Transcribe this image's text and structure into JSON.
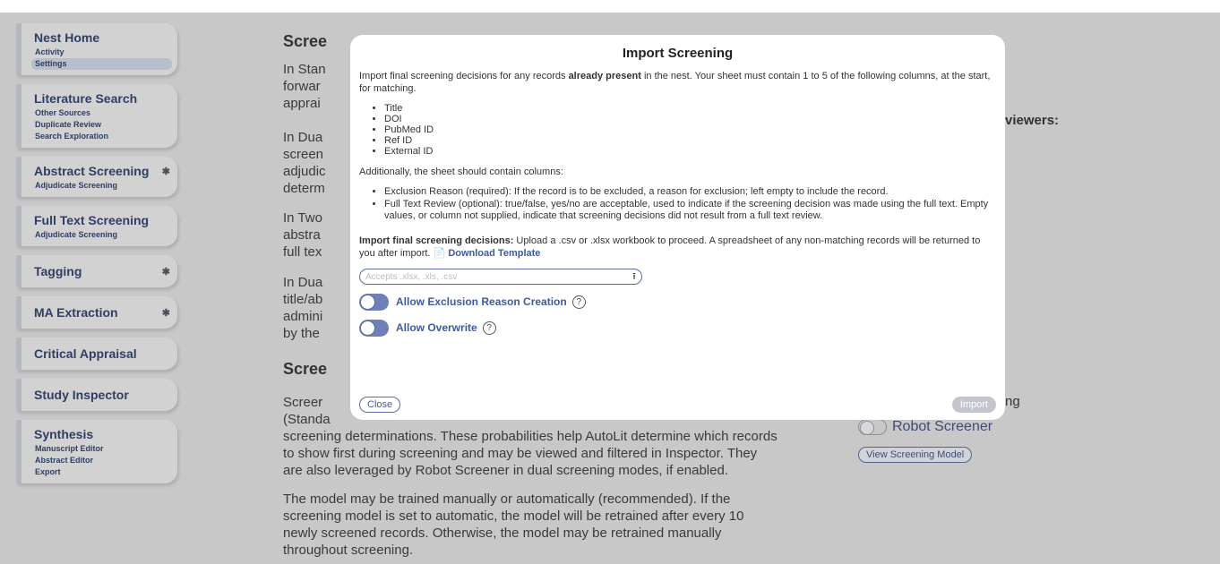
{
  "sidebar": {
    "groups": [
      {
        "title": "Nest Home",
        "gear": false,
        "items": [
          "Activity",
          "Settings"
        ],
        "active": "Settings"
      },
      {
        "title": "Literature Search",
        "gear": false,
        "items": [
          "Other Sources",
          "Duplicate Review",
          "Search Exploration"
        ]
      },
      {
        "title": "Abstract Screening",
        "gear": true,
        "items": [
          "Adjudicate Screening"
        ]
      },
      {
        "title": "Full Text Screening",
        "gear": false,
        "items": [
          "Adjudicate Screening"
        ]
      },
      {
        "title": "Tagging",
        "gear": true,
        "items": []
      },
      {
        "title": "MA Extraction",
        "gear": true,
        "items": []
      },
      {
        "title": "Critical Appraisal",
        "gear": false,
        "items": []
      },
      {
        "title": "Study Inspector",
        "gear": false,
        "items": []
      },
      {
        "title": "Synthesis",
        "gear": false,
        "items": [
          "Manuscript Editor",
          "Abstract Editor",
          "Export"
        ]
      }
    ]
  },
  "background": {
    "heading1": "Scree",
    "heading2": "Scree",
    "lines_p1": [
      "In Stan",
      "forwar",
      "apprai"
    ],
    "lines_p2": [
      "In Dua",
      "screen",
      "adjudic",
      "determ"
    ],
    "lines_p3": [
      "In Two",
      "abstra",
      "full tex"
    ],
    "lines_p4": [
      "In Dua",
      "title/ab",
      "admini",
      "by the"
    ],
    "lines_p5": [
      "Screer",
      "(Standa"
    ],
    "para_full_1": [
      "screening determinations. These probabilities help AutoLit determine which records",
      "to show first during screening and may be viewed and filtered in Inspector. They",
      "are also leveraged by Robot Screener in dual screening modes, if enabled."
    ],
    "para_full_2": [
      "The model may be trained manually or automatically (recommended). If the",
      "screening model is set to automatic, the model will be retrained after every 10",
      "newly screened records. Otherwise, the model may be retrained manually",
      "throughout screening."
    ],
    "right_viewers": "viewers:",
    "right_ng": "ng",
    "robot_screener": "Robot Screener",
    "view_model_button": "View Screening Model"
  },
  "modal": {
    "title": "Import Screening",
    "intro_pre": "Import final screening decisions for any records ",
    "intro_bold": "already present",
    "intro_post": " in the nest. Your sheet must contain 1 to 5 of the following columns, at the start, for matching.",
    "match_columns": [
      "Title",
      "DOI",
      "PubMed ID",
      "Ref ID",
      "External ID"
    ],
    "additional": "Additionally, the sheet should contain columns:",
    "extra_columns": [
      "Exclusion Reason (required): If the record is to be excluded, a reason for exclusion; left empty to include the record.",
      "Full Text Review (optional): true/false, yes/no are acceptable, used to indicate if the screening decision was made using the full text. Empty values, or column not supplied, indicate that screening decisions did not result from a full text review."
    ],
    "import_bold": "Import final screening decisions:",
    "import_text": " Upload a .csv or .xlsx workbook to proceed. A spreadsheet of any non-matching records will be returned to you after import. ",
    "download_template": "Download Template",
    "file_placeholder": "Accepts .xlsx, .xls, .csv",
    "toggle1_label": "Allow Exclusion Reason Creation",
    "toggle2_label": "Allow Overwrite",
    "help_glyph": "?",
    "close_label": "Close",
    "import_label": "Import"
  }
}
